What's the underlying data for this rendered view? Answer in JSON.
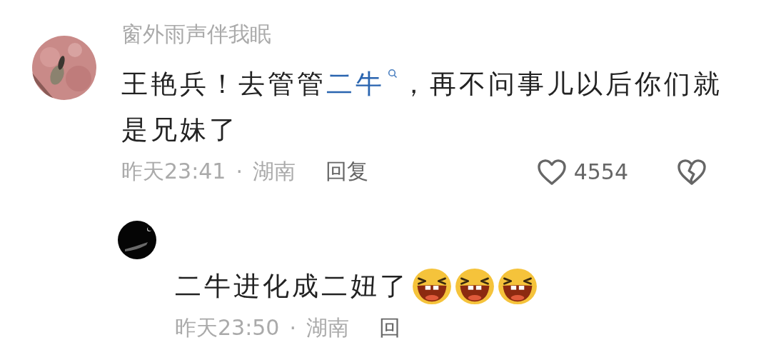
{
  "comment": {
    "username": "窗外雨声伴我眠",
    "text": [
      {
        "kind": "plain",
        "text": "王艳兵！去管管"
      },
      {
        "kind": "link",
        "text": "二牛"
      },
      {
        "kind": "plain",
        "text": "，再不问事儿以后你们就是兄妹了"
      }
    ],
    "time": "昨天23:41",
    "separator": "·",
    "location": "湖南",
    "reply": "回复",
    "likes": "4554"
  },
  "reply": {
    "text": "二牛进化成二妞了",
    "emojis": [
      {
        "kind": "laugh"
      },
      {
        "kind": "laugh"
      },
      {
        "kind": "laugh"
      }
    ],
    "time": "昨天23:50",
    "separator": "·",
    "location": "湖南",
    "reply": "回"
  }
}
